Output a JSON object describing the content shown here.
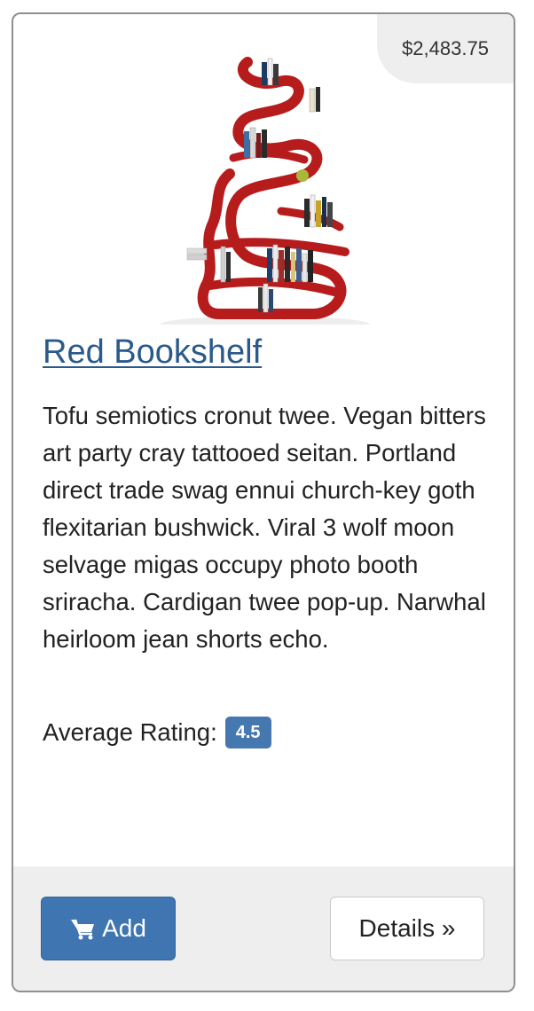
{
  "product": {
    "price": "$2,483.75",
    "image_alt": "Red bookshelf with books",
    "title": "Red Bookshelf",
    "description": "Tofu semiotics cronut twee. Vegan bitters art party cray tattooed seitan. Portland direct trade swag ennui church-key goth flexitarian bushwick. Viral 3 wolf moon selvage migas occupy photo booth sriracha. Cardigan twee pop-up. Narwhal heirloom jean shorts echo.",
    "rating_label": "Average Rating:",
    "rating_value": "4.5"
  },
  "actions": {
    "add_label": "Add",
    "add_icon": "cart-icon",
    "details_label": "Details »"
  },
  "colors": {
    "link": "#2a5a8c",
    "primary": "#3f75b0",
    "badge": "#4678b0",
    "shelf": "#b71c1c"
  }
}
